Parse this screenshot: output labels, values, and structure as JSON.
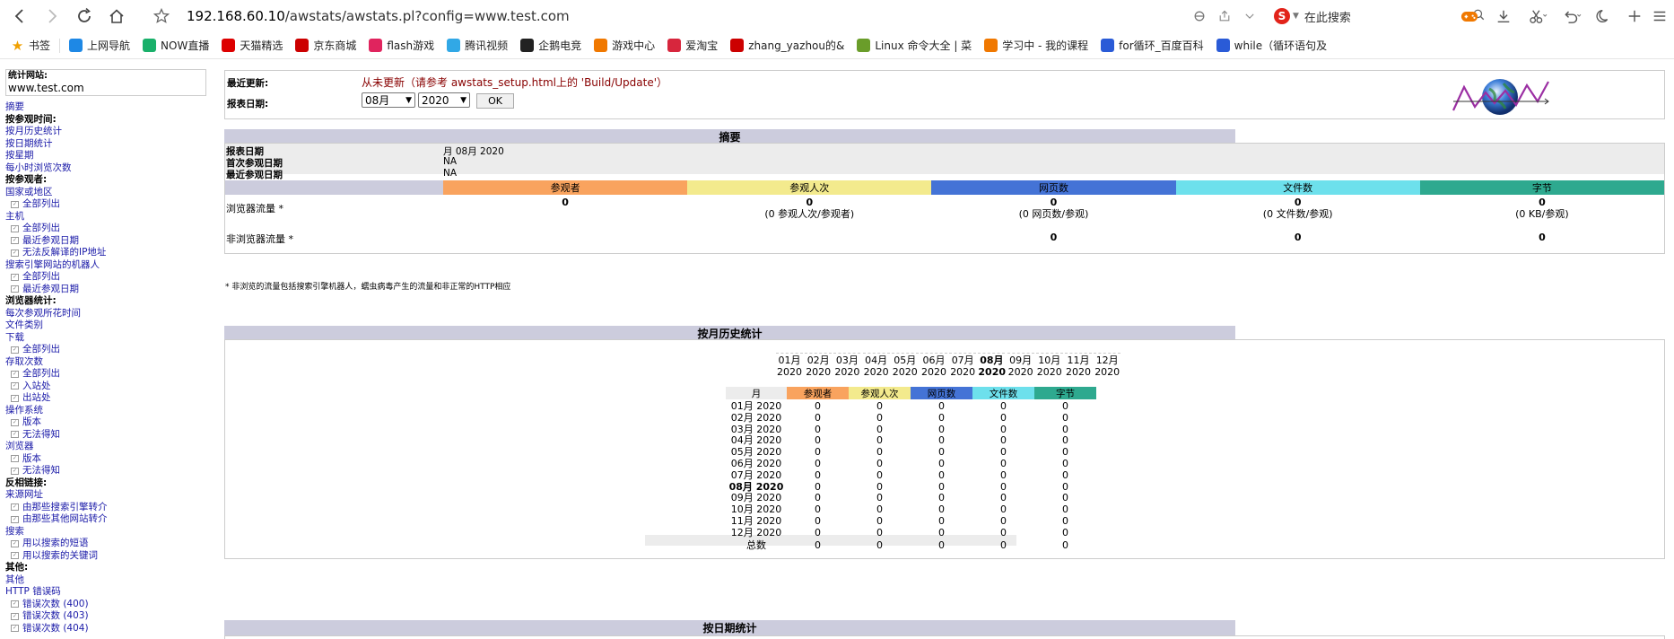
{
  "browser": {
    "url_host": "192.168.60.10",
    "url_path": "/awstats/awstats.pl?config=www.test.com",
    "search_placeholder": "在此搜索",
    "bookmarks": [
      {
        "label": "书签",
        "icon": "star-icon",
        "color": "#f0a000"
      },
      {
        "label": "上网导航",
        "icon": "e-icon",
        "color": "#1e88e5"
      },
      {
        "label": "NOW直播",
        "icon": "now-icon",
        "color": "#19b06a"
      },
      {
        "label": "天猫精选",
        "icon": "tmall-icon",
        "color": "#d00"
      },
      {
        "label": "京东商城",
        "icon": "jd-icon",
        "color": "#c00"
      },
      {
        "label": "flash游戏",
        "icon": "flash-icon",
        "color": "#e0245e"
      },
      {
        "label": "腾讯视频",
        "icon": "play-icon",
        "color": "#31a8e6"
      },
      {
        "label": "企鹅电竞",
        "icon": "penguin-icon",
        "color": "#222"
      },
      {
        "label": "游戏中心",
        "icon": "gamepad-icon",
        "color": "#f07800"
      },
      {
        "label": "爱淘宝",
        "icon": "taobao-icon",
        "color": "#d7263d"
      },
      {
        "label": "zhang_yazhou的&",
        "icon": "c-icon",
        "color": "#c00"
      },
      {
        "label": "Linux 命令大全 | 菜",
        "icon": "runoob-icon",
        "color": "#6a9d2a"
      },
      {
        "label": "学习中 - 我的课程",
        "icon": "bilibili-icon",
        "color": "#f07800"
      },
      {
        "label": "for循环_百度百科",
        "icon": "baidu-paw-icon",
        "color": "#2a5bd7"
      },
      {
        "label": "while（循环语句及",
        "icon": "baidu-paw-icon",
        "color": "#2a5bd7"
      }
    ]
  },
  "menu": {
    "site_label": "统计网站:",
    "site_value": "www.test.com",
    "items": [
      {
        "text": "摘要",
        "kind": "link"
      },
      {
        "text": "按参观时间:",
        "kind": "head"
      },
      {
        "text": "按月历史统计",
        "kind": "link"
      },
      {
        "text": "按日期统计",
        "kind": "link"
      },
      {
        "text": "按星期",
        "kind": "link"
      },
      {
        "text": "每小时浏览次数",
        "kind": "link"
      },
      {
        "text": "按参观者:",
        "kind": "head"
      },
      {
        "text": "国家或地区",
        "kind": "link"
      },
      {
        "text": "全部列出",
        "kind": "sub"
      },
      {
        "text": "主机",
        "kind": "link"
      },
      {
        "text": "全部列出",
        "kind": "sub"
      },
      {
        "text": "最近参观日期",
        "kind": "sub"
      },
      {
        "text": "无法反解译的IP地址",
        "kind": "sub"
      },
      {
        "text": "搜索引擎网站的机器人",
        "kind": "link"
      },
      {
        "text": "全部列出",
        "kind": "sub"
      },
      {
        "text": "最近参观日期",
        "kind": "sub"
      },
      {
        "text": "浏览器统计:",
        "kind": "head"
      },
      {
        "text": "每次参观所花时间",
        "kind": "link"
      },
      {
        "text": "文件类别",
        "kind": "link"
      },
      {
        "text": "下载",
        "kind": "link"
      },
      {
        "text": "全部列出",
        "kind": "sub"
      },
      {
        "text": "存取次数",
        "kind": "link"
      },
      {
        "text": "全部列出",
        "kind": "sub"
      },
      {
        "text": "入站处",
        "kind": "sub"
      },
      {
        "text": "出站处",
        "kind": "sub"
      },
      {
        "text": "操作系统",
        "kind": "link"
      },
      {
        "text": "版本",
        "kind": "sub"
      },
      {
        "text": "无法得知",
        "kind": "sub"
      },
      {
        "text": "浏览器",
        "kind": "link"
      },
      {
        "text": "版本",
        "kind": "sub"
      },
      {
        "text": "无法得知",
        "kind": "sub"
      },
      {
        "text": "反相链接:",
        "kind": "head"
      },
      {
        "text": "来源网址",
        "kind": "link"
      },
      {
        "text": "由那些搜索引擎转介",
        "kind": "sub"
      },
      {
        "text": "由那些其他网站转介",
        "kind": "sub"
      },
      {
        "text": "搜索",
        "kind": "link"
      },
      {
        "text": "用以搜索的短语",
        "kind": "sub"
      },
      {
        "text": "用以搜索的关键词",
        "kind": "sub"
      },
      {
        "text": "其他:",
        "kind": "head"
      },
      {
        "text": "其他",
        "kind": "link"
      },
      {
        "text": "HTTP 错误码",
        "kind": "link"
      },
      {
        "text": "错误次数 (400)",
        "kind": "sub"
      },
      {
        "text": "错误次数 (403)",
        "kind": "sub"
      },
      {
        "text": "错误次数 (404)",
        "kind": "sub"
      }
    ]
  },
  "top": {
    "last_update_label": "最近更新:",
    "last_update_value": "从未更新（请参考 awstats_setup.html上的 'Build/Update'）",
    "report_date_label": "报表日期:",
    "month_select": "08月",
    "year_select": "2020",
    "ok_label": "OK"
  },
  "summary": {
    "title": "摘要",
    "report_date_label": "报表日期",
    "report_date_value": "月 08月 2020",
    "first_visit_label": "首次参观日期",
    "first_visit_value": "NA",
    "last_visit_label": "最近参观日期",
    "last_visit_value": "NA",
    "headers": [
      "参观者",
      "参观人次",
      "网页数",
      "文件数",
      "字节"
    ],
    "header_colors": [
      "#f9a35e",
      "#f3ea8d",
      "#4473d6",
      "#6de0ec",
      "#2ea98f"
    ],
    "viewed_label": "浏览器流量 *",
    "viewed_values": [
      "0",
      "0",
      "0",
      "0",
      "0"
    ],
    "viewed_sub": [
      "",
      "(0 参观人次/参观者)",
      "(0 网页数/参观)",
      "(0 文件数/参观)",
      "(0 KB/参观)"
    ],
    "not_viewed_label": "非浏览器流量 *",
    "not_viewed_values": [
      "",
      "",
      "0",
      "0",
      "0"
    ],
    "footnote": "* 非浏览的流量包括搜索引擎机器人，蠕虫病毒产生的流量和非正常的HTTP相应"
  },
  "monthly": {
    "title": "按月历史统计",
    "columns": [
      {
        "m": "01月",
        "y": "2020"
      },
      {
        "m": "02月",
        "y": "2020"
      },
      {
        "m": "03月",
        "y": "2020"
      },
      {
        "m": "04月",
        "y": "2020"
      },
      {
        "m": "05月",
        "y": "2020"
      },
      {
        "m": "06月",
        "y": "2020"
      },
      {
        "m": "07月",
        "y": "2020"
      },
      {
        "m": "08月",
        "y": "2020"
      },
      {
        "m": "09月",
        "y": "2020"
      },
      {
        "m": "10月",
        "y": "2020"
      },
      {
        "m": "11月",
        "y": "2020"
      },
      {
        "m": "12月",
        "y": "2020"
      }
    ],
    "table_headers": [
      "月",
      "参观者",
      "参观人次",
      "网页数",
      "文件数",
      "字节"
    ],
    "rows": [
      {
        "month": "01月 2020",
        "values": [
          "0",
          "0",
          "0",
          "0",
          "0"
        ]
      },
      {
        "month": "02月 2020",
        "values": [
          "0",
          "0",
          "0",
          "0",
          "0"
        ]
      },
      {
        "month": "03月 2020",
        "values": [
          "0",
          "0",
          "0",
          "0",
          "0"
        ]
      },
      {
        "month": "04月 2020",
        "values": [
          "0",
          "0",
          "0",
          "0",
          "0"
        ]
      },
      {
        "month": "05月 2020",
        "values": [
          "0",
          "0",
          "0",
          "0",
          "0"
        ]
      },
      {
        "month": "06月 2020",
        "values": [
          "0",
          "0",
          "0",
          "0",
          "0"
        ]
      },
      {
        "month": "07月 2020",
        "values": [
          "0",
          "0",
          "0",
          "0",
          "0"
        ]
      },
      {
        "month": "08月 2020",
        "values": [
          "0",
          "0",
          "0",
          "0",
          "0"
        ],
        "current": true
      },
      {
        "month": "09月 2020",
        "values": [
          "0",
          "0",
          "0",
          "0",
          "0"
        ]
      },
      {
        "month": "10月 2020",
        "values": [
          "0",
          "0",
          "0",
          "0",
          "0"
        ]
      },
      {
        "month": "11月 2020",
        "values": [
          "0",
          "0",
          "0",
          "0",
          "0"
        ]
      },
      {
        "month": "12月 2020",
        "values": [
          "0",
          "0",
          "0",
          "0",
          "0"
        ]
      }
    ],
    "total_label": "总数",
    "total_values": [
      "0",
      "0",
      "0",
      "0",
      "0"
    ]
  },
  "daily": {
    "title": "按日期统计"
  }
}
